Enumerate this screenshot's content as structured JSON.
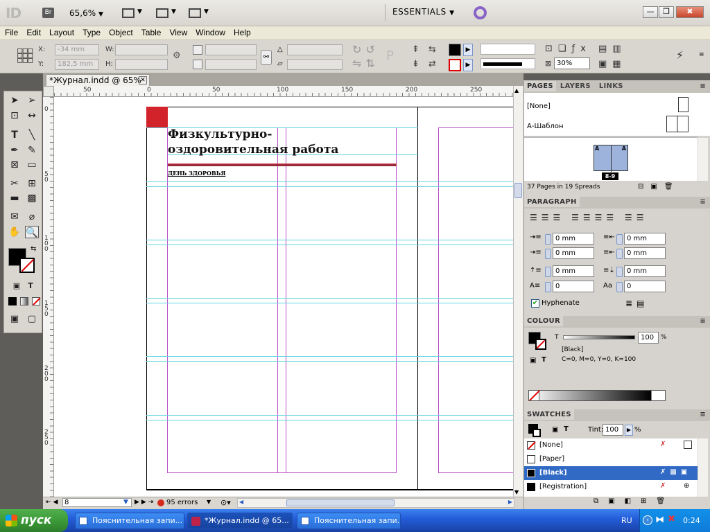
{
  "app": {
    "logo": "ID",
    "bridge": "Br",
    "zoom": "65,6%",
    "workspace": "ESSENTIALS"
  },
  "window_buttons": {
    "minimize": "—",
    "restore": "❐",
    "close": "✖"
  },
  "menu": [
    "File",
    "Edit",
    "Layout",
    "Type",
    "Object",
    "Table",
    "View",
    "Window",
    "Help"
  ],
  "control": {
    "x_label": "X:",
    "x_value": "-34 mm",
    "y_label": "Y:",
    "y_value": "182,5 mm",
    "w_label": "W:",
    "h_label": "H:",
    "opacity": "30%"
  },
  "document": {
    "tab_title": "*Журнал.indd @ 65%",
    "heading": "Физкультурно-оздоровительная работа",
    "subheading": "ДЕНЬ ЗДОРОВЬЯ",
    "h_ruler": [
      "50",
      "0",
      "50",
      "100",
      "150",
      "200",
      "250"
    ],
    "v_ruler": [
      "0",
      "5\n0",
      "1\n0\n0",
      "1\n5\n0",
      "2\n0\n0",
      "2\n5\n0"
    ]
  },
  "status": {
    "page": "8",
    "errors": "95 errors"
  },
  "pages_panel": {
    "tabs": [
      "PAGES",
      "LAYERS",
      "LINKS"
    ],
    "none_label": "[None]",
    "master_label": "А-Шаблон",
    "spread_label": "8-9",
    "master_letter": "A",
    "summary": "37 Pages in 19 Spreads"
  },
  "paragraph_panel": {
    "title": "PARAGRAPH",
    "left_indent": "0 mm",
    "right_indent": "0 mm",
    "first_line": "0 mm",
    "last_line": "0 mm",
    "space_before": "0 mm",
    "space_after": "0 mm",
    "drop_lines": "0",
    "drop_chars": "0",
    "hyphenate": "Hyphenate"
  },
  "colour_panel": {
    "title": "COLOUR",
    "t_label": "T",
    "tint": "100",
    "pct": "%",
    "name": "[Black]",
    "values": "C=0, M=0, Y=0, K=100"
  },
  "swatches_panel": {
    "title": "SWATCHES",
    "tint_label": "Tint:",
    "tint": "100",
    "pct": "%",
    "items": [
      "[None]",
      "[Paper]",
      "[Black]",
      "[Registration]"
    ]
  },
  "taskbar": {
    "start": "пуск",
    "tasks": [
      "Пояснительная запи...",
      "*Журнал.indd @ 65...",
      "Пояснительная запи..."
    ],
    "lang": "RU",
    "time": "0:24"
  },
  "colors": {
    "accent_red": "#d2232a",
    "margin_magenta": "#b84fc4",
    "guide_cyan": "#5fd3e0",
    "selection_blue": "#316ac5"
  }
}
